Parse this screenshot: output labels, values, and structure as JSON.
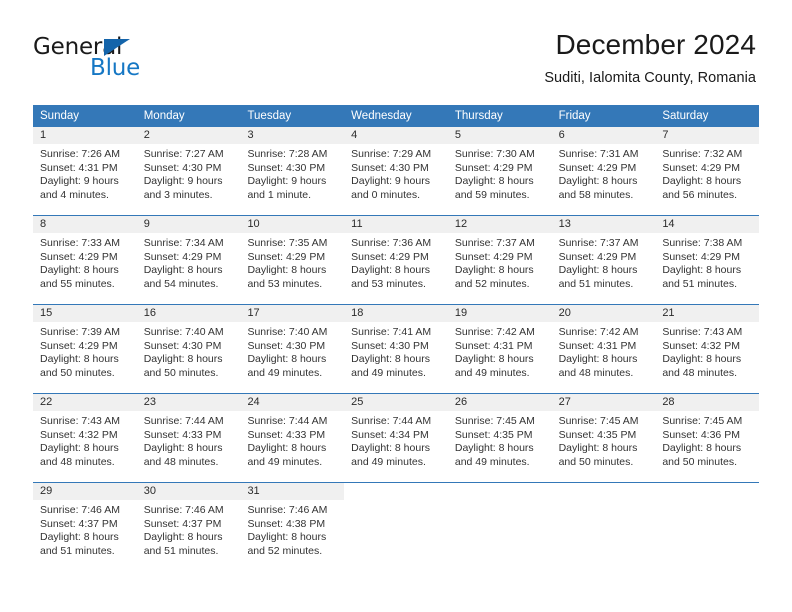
{
  "brand": {
    "name_part1": "General",
    "name_part2": "Blue",
    "logo_icon": "triangle-logo-icon"
  },
  "header": {
    "title": "December 2024",
    "subtitle": "Suditi, Ialomita County, Romania"
  },
  "colors": {
    "header_blue": "#3478b8",
    "brand_blue": "#1577c4",
    "day_strip_gray": "#f0f0f0",
    "text": "#2b2b2b"
  },
  "weekdays": [
    "Sunday",
    "Monday",
    "Tuesday",
    "Wednesday",
    "Thursday",
    "Friday",
    "Saturday"
  ],
  "weeks": [
    [
      {
        "day": "1",
        "sunrise": "Sunrise: 7:26 AM",
        "sunset": "Sunset: 4:31 PM",
        "daylight1": "Daylight: 9 hours",
        "daylight2": "and 4 minutes."
      },
      {
        "day": "2",
        "sunrise": "Sunrise: 7:27 AM",
        "sunset": "Sunset: 4:30 PM",
        "daylight1": "Daylight: 9 hours",
        "daylight2": "and 3 minutes."
      },
      {
        "day": "3",
        "sunrise": "Sunrise: 7:28 AM",
        "sunset": "Sunset: 4:30 PM",
        "daylight1": "Daylight: 9 hours",
        "daylight2": "and 1 minute."
      },
      {
        "day": "4",
        "sunrise": "Sunrise: 7:29 AM",
        "sunset": "Sunset: 4:30 PM",
        "daylight1": "Daylight: 9 hours",
        "daylight2": "and 0 minutes."
      },
      {
        "day": "5",
        "sunrise": "Sunrise: 7:30 AM",
        "sunset": "Sunset: 4:29 PM",
        "daylight1": "Daylight: 8 hours",
        "daylight2": "and 59 minutes."
      },
      {
        "day": "6",
        "sunrise": "Sunrise: 7:31 AM",
        "sunset": "Sunset: 4:29 PM",
        "daylight1": "Daylight: 8 hours",
        "daylight2": "and 58 minutes."
      },
      {
        "day": "7",
        "sunrise": "Sunrise: 7:32 AM",
        "sunset": "Sunset: 4:29 PM",
        "daylight1": "Daylight: 8 hours",
        "daylight2": "and 56 minutes."
      }
    ],
    [
      {
        "day": "8",
        "sunrise": "Sunrise: 7:33 AM",
        "sunset": "Sunset: 4:29 PM",
        "daylight1": "Daylight: 8 hours",
        "daylight2": "and 55 minutes."
      },
      {
        "day": "9",
        "sunrise": "Sunrise: 7:34 AM",
        "sunset": "Sunset: 4:29 PM",
        "daylight1": "Daylight: 8 hours",
        "daylight2": "and 54 minutes."
      },
      {
        "day": "10",
        "sunrise": "Sunrise: 7:35 AM",
        "sunset": "Sunset: 4:29 PM",
        "daylight1": "Daylight: 8 hours",
        "daylight2": "and 53 minutes."
      },
      {
        "day": "11",
        "sunrise": "Sunrise: 7:36 AM",
        "sunset": "Sunset: 4:29 PM",
        "daylight1": "Daylight: 8 hours",
        "daylight2": "and 53 minutes."
      },
      {
        "day": "12",
        "sunrise": "Sunrise: 7:37 AM",
        "sunset": "Sunset: 4:29 PM",
        "daylight1": "Daylight: 8 hours",
        "daylight2": "and 52 minutes."
      },
      {
        "day": "13",
        "sunrise": "Sunrise: 7:37 AM",
        "sunset": "Sunset: 4:29 PM",
        "daylight1": "Daylight: 8 hours",
        "daylight2": "and 51 minutes."
      },
      {
        "day": "14",
        "sunrise": "Sunrise: 7:38 AM",
        "sunset": "Sunset: 4:29 PM",
        "daylight1": "Daylight: 8 hours",
        "daylight2": "and 51 minutes."
      }
    ],
    [
      {
        "day": "15",
        "sunrise": "Sunrise: 7:39 AM",
        "sunset": "Sunset: 4:29 PM",
        "daylight1": "Daylight: 8 hours",
        "daylight2": "and 50 minutes."
      },
      {
        "day": "16",
        "sunrise": "Sunrise: 7:40 AM",
        "sunset": "Sunset: 4:30 PM",
        "daylight1": "Daylight: 8 hours",
        "daylight2": "and 50 minutes."
      },
      {
        "day": "17",
        "sunrise": "Sunrise: 7:40 AM",
        "sunset": "Sunset: 4:30 PM",
        "daylight1": "Daylight: 8 hours",
        "daylight2": "and 49 minutes."
      },
      {
        "day": "18",
        "sunrise": "Sunrise: 7:41 AM",
        "sunset": "Sunset: 4:30 PM",
        "daylight1": "Daylight: 8 hours",
        "daylight2": "and 49 minutes."
      },
      {
        "day": "19",
        "sunrise": "Sunrise: 7:42 AM",
        "sunset": "Sunset: 4:31 PM",
        "daylight1": "Daylight: 8 hours",
        "daylight2": "and 49 minutes."
      },
      {
        "day": "20",
        "sunrise": "Sunrise: 7:42 AM",
        "sunset": "Sunset: 4:31 PM",
        "daylight1": "Daylight: 8 hours",
        "daylight2": "and 48 minutes."
      },
      {
        "day": "21",
        "sunrise": "Sunrise: 7:43 AM",
        "sunset": "Sunset: 4:32 PM",
        "daylight1": "Daylight: 8 hours",
        "daylight2": "and 48 minutes."
      }
    ],
    [
      {
        "day": "22",
        "sunrise": "Sunrise: 7:43 AM",
        "sunset": "Sunset: 4:32 PM",
        "daylight1": "Daylight: 8 hours",
        "daylight2": "and 48 minutes."
      },
      {
        "day": "23",
        "sunrise": "Sunrise: 7:44 AM",
        "sunset": "Sunset: 4:33 PM",
        "daylight1": "Daylight: 8 hours",
        "daylight2": "and 48 minutes."
      },
      {
        "day": "24",
        "sunrise": "Sunrise: 7:44 AM",
        "sunset": "Sunset: 4:33 PM",
        "daylight1": "Daylight: 8 hours",
        "daylight2": "and 49 minutes."
      },
      {
        "day": "25",
        "sunrise": "Sunrise: 7:44 AM",
        "sunset": "Sunset: 4:34 PM",
        "daylight1": "Daylight: 8 hours",
        "daylight2": "and 49 minutes."
      },
      {
        "day": "26",
        "sunrise": "Sunrise: 7:45 AM",
        "sunset": "Sunset: 4:35 PM",
        "daylight1": "Daylight: 8 hours",
        "daylight2": "and 49 minutes."
      },
      {
        "day": "27",
        "sunrise": "Sunrise: 7:45 AM",
        "sunset": "Sunset: 4:35 PM",
        "daylight1": "Daylight: 8 hours",
        "daylight2": "and 50 minutes."
      },
      {
        "day": "28",
        "sunrise": "Sunrise: 7:45 AM",
        "sunset": "Sunset: 4:36 PM",
        "daylight1": "Daylight: 8 hours",
        "daylight2": "and 50 minutes."
      }
    ],
    [
      {
        "day": "29",
        "sunrise": "Sunrise: 7:46 AM",
        "sunset": "Sunset: 4:37 PM",
        "daylight1": "Daylight: 8 hours",
        "daylight2": "and 51 minutes."
      },
      {
        "day": "30",
        "sunrise": "Sunrise: 7:46 AM",
        "sunset": "Sunset: 4:37 PM",
        "daylight1": "Daylight: 8 hours",
        "daylight2": "and 51 minutes."
      },
      {
        "day": "31",
        "sunrise": "Sunrise: 7:46 AM",
        "sunset": "Sunset: 4:38 PM",
        "daylight1": "Daylight: 8 hours",
        "daylight2": "and 52 minutes."
      },
      {
        "day": "",
        "sunrise": "",
        "sunset": "",
        "daylight1": "",
        "daylight2": ""
      },
      {
        "day": "",
        "sunrise": "",
        "sunset": "",
        "daylight1": "",
        "daylight2": ""
      },
      {
        "day": "",
        "sunrise": "",
        "sunset": "",
        "daylight1": "",
        "daylight2": ""
      },
      {
        "day": "",
        "sunrise": "",
        "sunset": "",
        "daylight1": "",
        "daylight2": ""
      }
    ]
  ]
}
